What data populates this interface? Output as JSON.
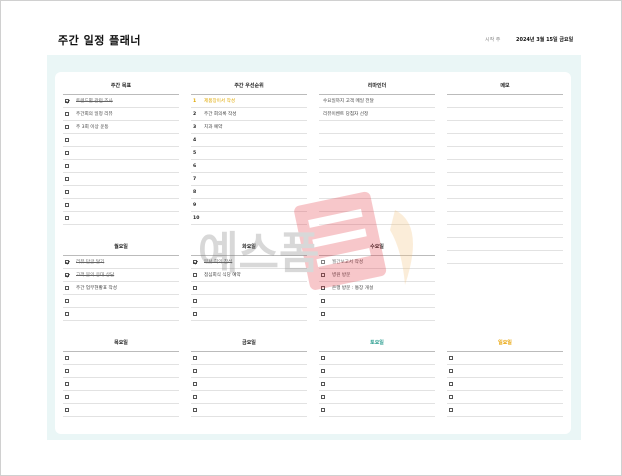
{
  "header": {
    "title": "주간 일정 플래너",
    "start_label": "시작 주",
    "start_date": "2024년 3월 15일 금요일"
  },
  "weekly_goals": {
    "title": "주간 목표",
    "items": [
      {
        "text": "트렌드별 관련 조사",
        "checked": true,
        "done": true
      },
      {
        "text": "주간회의 일정 리뷰",
        "checked": false,
        "done": false
      },
      {
        "text": "주 3회 이상 운동",
        "checked": false,
        "done": false
      },
      {
        "text": "",
        "checked": false,
        "done": false
      },
      {
        "text": "",
        "checked": false,
        "done": false
      },
      {
        "text": "",
        "checked": false,
        "done": false
      },
      {
        "text": "",
        "checked": false,
        "done": false
      },
      {
        "text": "",
        "checked": false,
        "done": false
      },
      {
        "text": "",
        "checked": false,
        "done": false
      },
      {
        "text": "",
        "checked": false,
        "done": false
      }
    ]
  },
  "weekly_priorities": {
    "title": "주간 우선순위",
    "items": [
      {
        "num": "1",
        "text": "제품장이서 작성",
        "highlight": true
      },
      {
        "num": "2",
        "text": "주간 회의록 작성",
        "highlight": false
      },
      {
        "num": "3",
        "text": "치과 예약",
        "highlight": false
      },
      {
        "num": "4",
        "text": "",
        "highlight": false
      },
      {
        "num": "5",
        "text": "",
        "highlight": false
      },
      {
        "num": "6",
        "text": "",
        "highlight": false
      },
      {
        "num": "7",
        "text": "",
        "highlight": false
      },
      {
        "num": "8",
        "text": "",
        "highlight": false
      },
      {
        "num": "9",
        "text": "",
        "highlight": false
      },
      {
        "num": "10",
        "text": "",
        "highlight": false
      }
    ]
  },
  "reminders": {
    "title": "리마인더",
    "items": [
      "수요일까지 고객 메일 전달",
      "리뷰이벤트 당첨자 선정",
      "",
      "",
      "",
      "",
      "",
      "",
      "",
      ""
    ]
  },
  "memo": {
    "title": "메모",
    "rows": 13
  },
  "days_top": [
    {
      "title": "월요일",
      "color": "",
      "items": [
        {
          "text": "리뷰 답글 달기",
          "checked": true,
          "done": true
        },
        {
          "text": "고객 문의 응대 상담",
          "checked": true,
          "done": true
        },
        {
          "text": "주간 업무현황표 작성",
          "checked": false,
          "done": false
        },
        {
          "text": "",
          "checked": false,
          "done": false
        },
        {
          "text": "",
          "checked": false,
          "done": false
        }
      ]
    },
    {
      "title": "화요일",
      "color": "",
      "items": [
        {
          "text": "부서 회의 참석",
          "checked": true,
          "done": true
        },
        {
          "text": "점심회식 식당 예약",
          "checked": false,
          "done": false
        },
        {
          "text": "",
          "checked": false,
          "done": false
        },
        {
          "text": "",
          "checked": false,
          "done": false
        },
        {
          "text": "",
          "checked": false,
          "done": false
        }
      ]
    },
    {
      "title": "수요일",
      "color": "",
      "items": [
        {
          "text": "월간보고서 작성",
          "checked": false,
          "done": false
        },
        {
          "text": "병원 방문",
          "checked": false,
          "done": false
        },
        {
          "text": "은행 방문 : 통장 개설",
          "checked": false,
          "done": false
        },
        {
          "text": "",
          "checked": false,
          "done": false
        },
        {
          "text": "",
          "checked": false,
          "done": false
        }
      ]
    }
  ],
  "days_bottom": [
    {
      "title": "목요일",
      "color": "",
      "rows": 5
    },
    {
      "title": "금요일",
      "color": "",
      "rows": 5
    },
    {
      "title": "토요일",
      "color": "#2a9d8f",
      "rows": 5
    },
    {
      "title": "일요일",
      "color": "#e8a100",
      "rows": 5
    }
  ],
  "watermark": {
    "text": "예스폼"
  }
}
